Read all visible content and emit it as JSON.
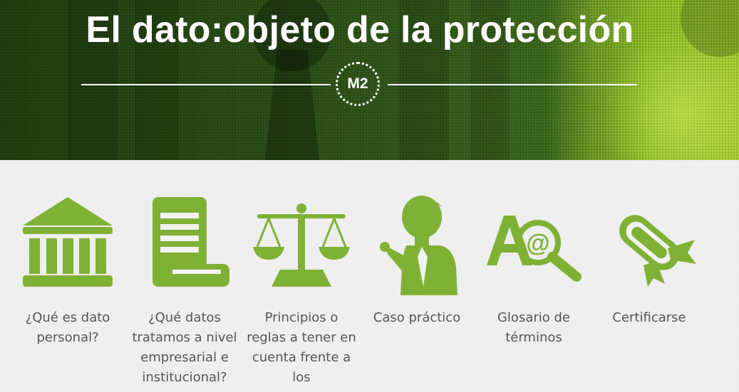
{
  "header": {
    "title": "El dato:objeto de la protección",
    "module_badge": "M2"
  },
  "colors": {
    "accent": "#7fb135",
    "banner_dark": "#2a4c16",
    "banner_light": "#a4cc31",
    "label_text": "#555555"
  },
  "menu": {
    "items": [
      {
        "icon": "bank-icon",
        "label": "¿Qué es dato personal?"
      },
      {
        "icon": "document-scroll-icon",
        "label": "¿Qué datos tratamos a nivel empresarial e institucional?"
      },
      {
        "icon": "scales-icon",
        "label": "Principios o reglas a tener en cuenta frente a los"
      },
      {
        "icon": "person-pointing-icon",
        "label": "Caso práctico"
      },
      {
        "icon": "glossary-magnifier-icon",
        "label": "Glosario de términos"
      },
      {
        "icon": "diploma-icon",
        "label": "Certificarse"
      }
    ]
  }
}
